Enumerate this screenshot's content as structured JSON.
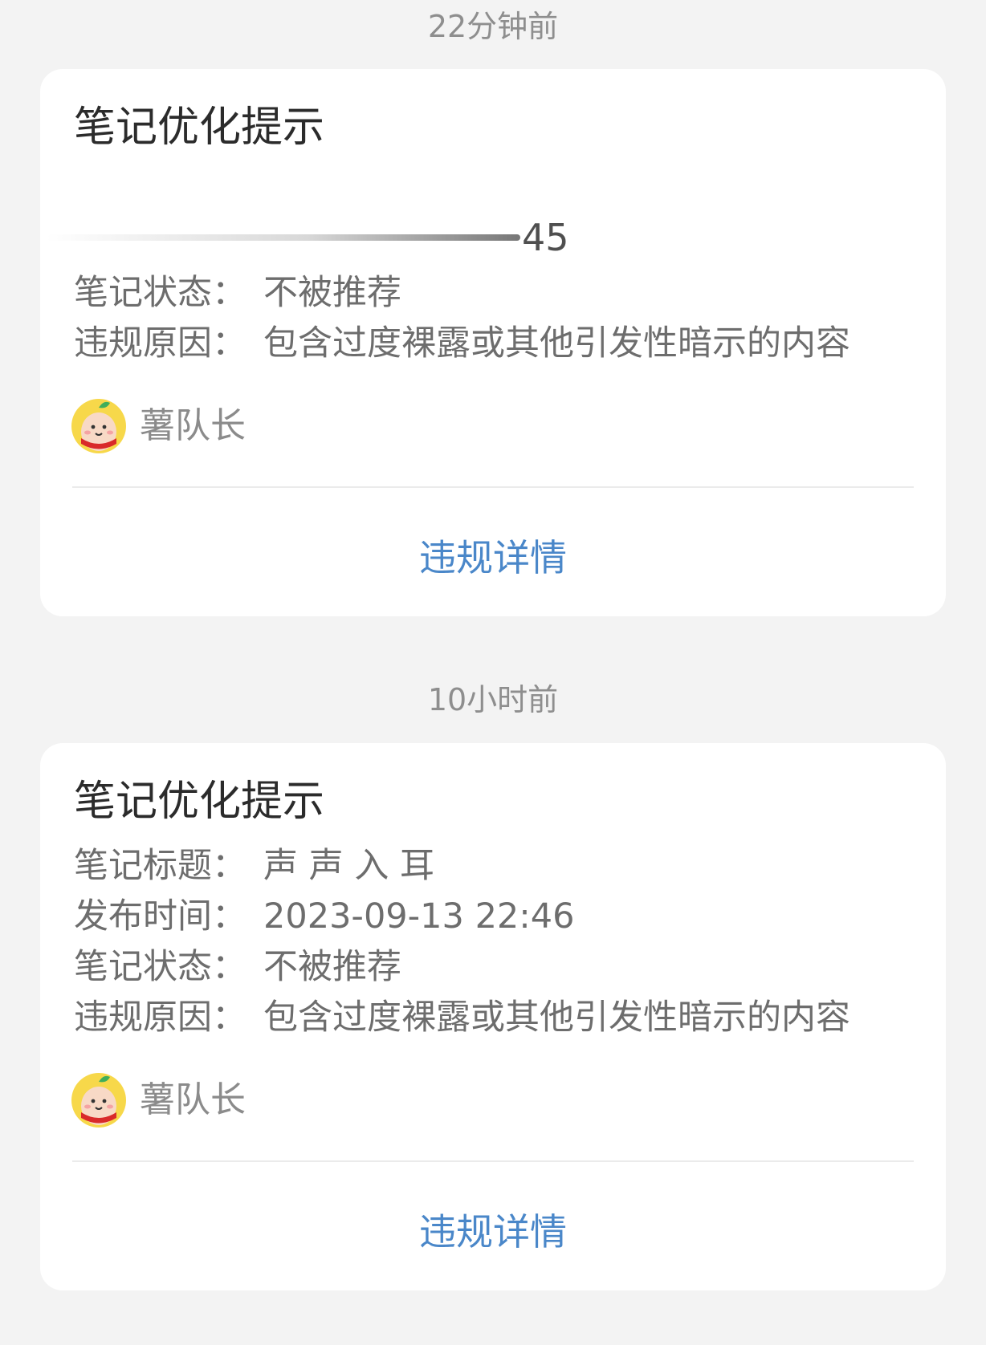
{
  "notifications": [
    {
      "time": "22分钟前",
      "title": "笔记优化提示",
      "progress_number": "45",
      "fields": [
        {
          "label": "笔记状态：",
          "value": "不被推荐"
        },
        {
          "label": "违规原因：",
          "value": "包含过度裸露或其他引发性暗示的内容"
        }
      ],
      "author": "薯队长",
      "action": "违规详情"
    },
    {
      "time": "10小时前",
      "title": "笔记优化提示",
      "fields": [
        {
          "label": "笔记标题：",
          "value": "声 声 入 耳"
        },
        {
          "label": "发布时间：",
          "value": "2023-09-13 22:46"
        },
        {
          "label": "笔记状态：",
          "value": "不被推荐"
        },
        {
          "label": "违规原因：",
          "value": "包含过度裸露或其他引发性暗示的内容"
        }
      ],
      "author": "薯队长",
      "action": "违规详情"
    }
  ],
  "colors": {
    "background": "#f3f3f3",
    "card": "#ffffff",
    "link": "#4a87c9",
    "title": "#2b2b2b",
    "muted": "#8e8e8e"
  },
  "icons": {
    "avatar": "potato-mascot-avatar"
  }
}
